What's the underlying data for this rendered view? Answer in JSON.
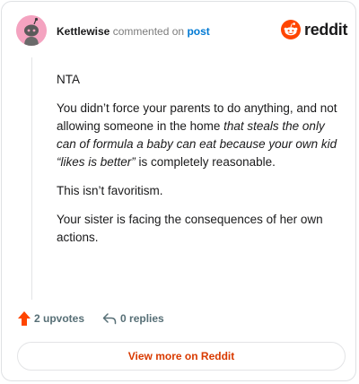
{
  "header": {
    "username": "Kettlewise",
    "action_text": "commented on",
    "post_link": "post",
    "brand": "reddit"
  },
  "comment": {
    "p1": "NTA",
    "p2_plain": "You didn’t force your parents to do anything, and not allowing someone in the home ",
    "p2_italic": "that steals the only can of formula a baby can eat because your own kid “likes is better”",
    "p2_tail": " is completely reasonable.",
    "p3": "This isn’t favoritism.",
    "p4": "Your sister is facing the consequences of her own actions."
  },
  "footer": {
    "upvotes": "2 upvotes",
    "replies": "0 replies",
    "view_more": "View more on Reddit"
  },
  "colors": {
    "upvote": "#ff4500",
    "link": "#0079d3",
    "cta": "#d93a00",
    "avatar_bg": "#f4a3c0"
  },
  "icons": [
    "avatar-snoo-icon",
    "reddit-logo-icon",
    "upvote-arrow-icon",
    "reply-arrow-icon"
  ]
}
